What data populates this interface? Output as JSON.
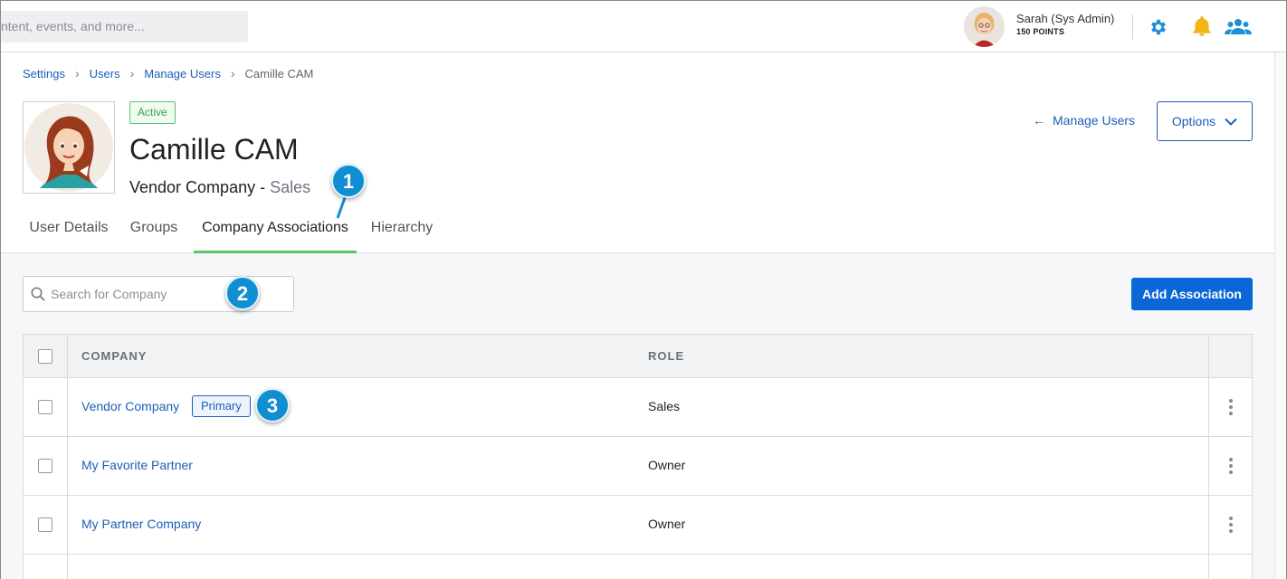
{
  "topbar": {
    "search_text": "ntent, events, and more...",
    "user_name": "Sarah (Sys Admin)",
    "user_points": "150 POINTS",
    "icons": [
      "gear-icon",
      "bell-icon",
      "people-icon"
    ],
    "accent_color": "#1d8fd8",
    "bell_color": "#f2b516"
  },
  "breadcrumb": {
    "items": [
      "Settings",
      "Users",
      "Manage Users"
    ],
    "current": "Camille CAM"
  },
  "profile": {
    "status": "Active",
    "name": "Camille CAM",
    "company": "Vendor Company",
    "separator": " - ",
    "role": "Sales"
  },
  "actions": {
    "back_label": "Manage Users",
    "options_label": "Options"
  },
  "tabs": [
    {
      "label": "User Details",
      "active": false
    },
    {
      "label": "Groups",
      "active": false
    },
    {
      "label": "Company Associations",
      "active": true
    },
    {
      "label": "Hierarchy",
      "active": false
    }
  ],
  "company_search": {
    "placeholder": "Search for Company"
  },
  "add_button": "Add Association",
  "table": {
    "columns": [
      "COMPANY",
      "ROLE"
    ],
    "rows": [
      {
        "company": "Vendor Company",
        "badge": "Primary",
        "role": "Sales"
      },
      {
        "company": "My Favorite Partner",
        "role": "Owner"
      },
      {
        "company": "My Partner Company",
        "role": "Owner"
      }
    ]
  },
  "callouts": [
    "1",
    "2",
    "3"
  ],
  "colors": {
    "link": "#1d5fb7",
    "primary_button": "#0b66d8",
    "active_tab_underline": "#5cc46a",
    "active_badge": "#36a145",
    "callout": "#0f8fd2"
  }
}
